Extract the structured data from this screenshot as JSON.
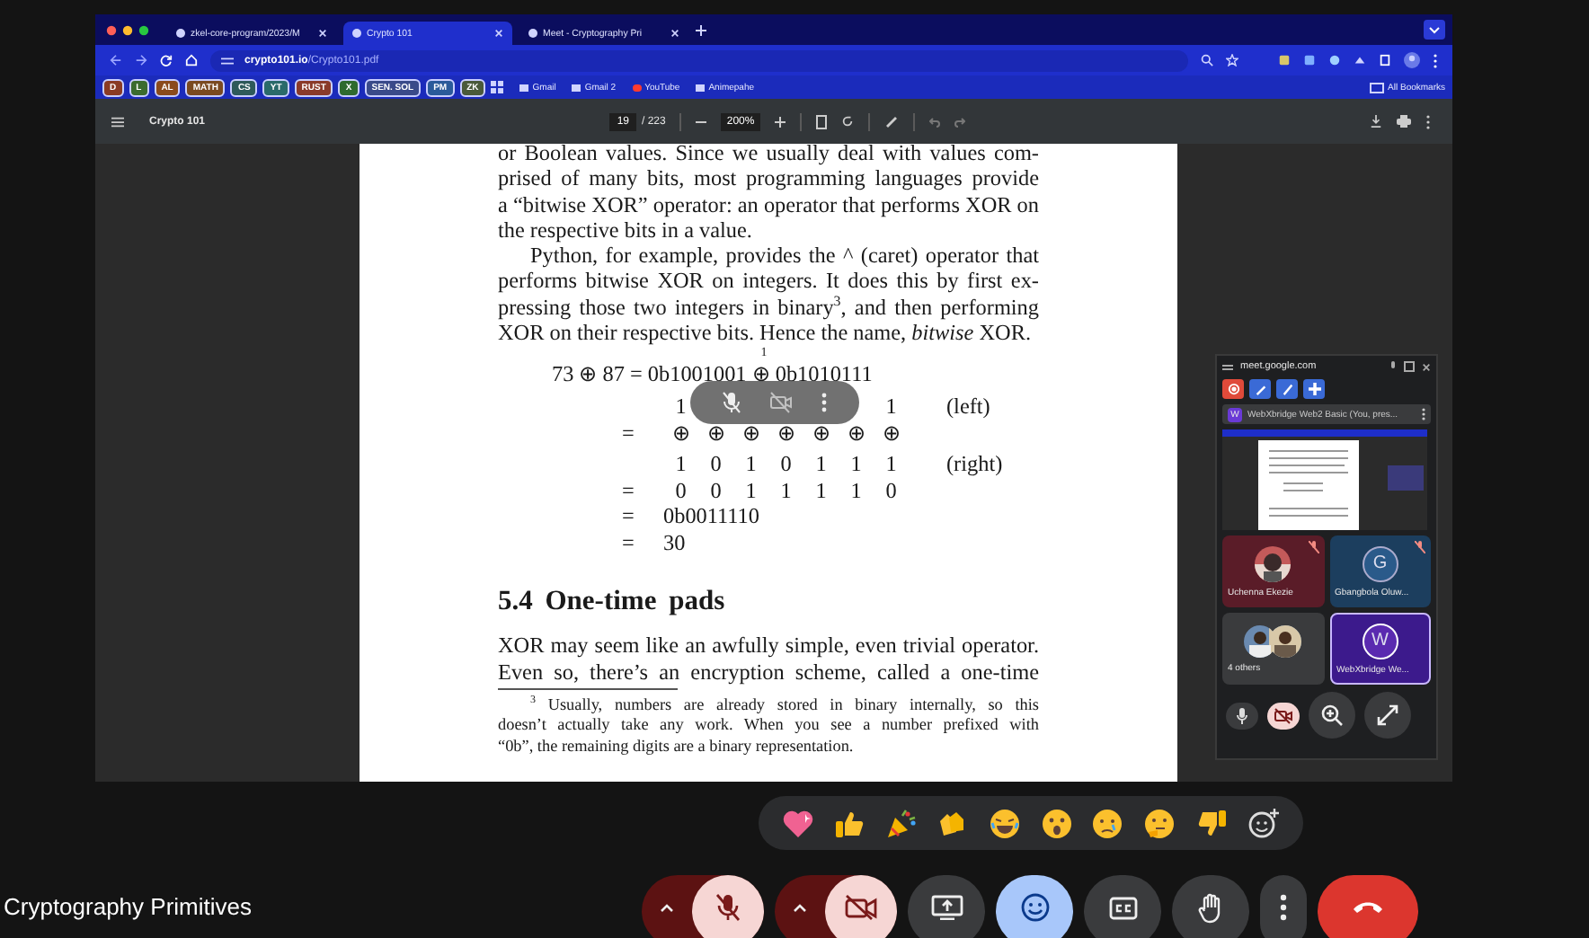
{
  "browser": {
    "tabs": [
      {
        "title": "zkel-core-program/2023/M",
        "selected": false
      },
      {
        "title": "Crypto 101",
        "selected": true
      },
      {
        "title": "Meet - Cryptography Pri",
        "selected": false
      }
    ],
    "url": {
      "host": "crypto101.io",
      "path": "/Crypto101.pdf"
    },
    "bookmarks": [
      {
        "label": "D",
        "kind": "chip",
        "color": "#8a3b24"
      },
      {
        "label": "L",
        "kind": "chip",
        "color": "#3b6b2e"
      },
      {
        "label": "AL",
        "kind": "chip",
        "color": "#8a4a1c"
      },
      {
        "label": "MATH",
        "kind": "chip",
        "color": "#7a4a20"
      },
      {
        "label": "CS",
        "kind": "chip",
        "color": "#2e5a5a"
      },
      {
        "label": "YT",
        "kind": "chip",
        "color": "#2a6a6a"
      },
      {
        "label": "RUST",
        "kind": "chip",
        "color": "#8a3a2a"
      },
      {
        "label": "X",
        "kind": "chip",
        "color": "#2e6a2e"
      },
      {
        "label": "SEN. SOL",
        "kind": "chip",
        "color": "#3a4a8a"
      },
      {
        "label": "PM",
        "kind": "chip",
        "color": "#2a5a9a"
      },
      {
        "label": "ZK",
        "kind": "chip",
        "color": "#4a5a3a"
      },
      {
        "label": "Gmail",
        "kind": "link"
      },
      {
        "label": "Gmail 2",
        "kind": "link"
      },
      {
        "label": "YouTube",
        "kind": "video"
      },
      {
        "label": "Animepahe",
        "kind": "link"
      }
    ],
    "all_bookmarks": "All Bookmarks"
  },
  "pdf": {
    "title": "Crypto 101",
    "page": "19",
    "page_count": "/ 223",
    "zoom": "200%",
    "paragraphs": [
      {
        "indent": false,
        "lines": [
          "or Boolean values. Since we usually deal with values com-",
          "prised of many bits, most programming languages provide",
          "a “bitwise XOR” operator: an operator that performs XOR on",
          "the respective bits in a value."
        ]
      },
      {
        "indent": true,
        "lines": [
          "Python, for example, provides the ^ (caret) operator that",
          "performs bitwise XOR on integers. It does this by first ex-",
          "pressing those two integers in binary$^{3}$, and then performing",
          "XOR on their respective bits. Hence the name, *bitwise* XOR."
        ]
      }
    ],
    "math": {
      "marker": "1",
      "equation": "73 ⊕ 87 = 0b1001001 ⊕ 0b1010111",
      "rows": [
        {
          "cells": [
            "1",
            "",
            "",
            "",
            "",
            "",
            "1"
          ],
          "note": "(left)"
        },
        {
          "op": "=",
          "cells": [
            "⊕",
            "⊕",
            "⊕",
            "⊕",
            "⊕",
            "⊕",
            "⊕"
          ]
        },
        {
          "cells": [
            "1",
            "0",
            "1",
            "0",
            "1",
            "1",
            "1"
          ],
          "note": "(right)"
        },
        {
          "op": "=",
          "cells": [
            "0",
            "0",
            "1",
            "1",
            "1",
            "1",
            "0"
          ]
        }
      ],
      "results": [
        {
          "op": "=",
          "value": "0b0011110"
        },
        {
          "op": "=",
          "value": "30"
        }
      ]
    },
    "heading": "5.4  One-time pads",
    "after_heading": [
      "XOR may seem like an awfully simple, even trivial operator.",
      "Even so, there’s an encryption scheme, called a one-time"
    ],
    "footnote": [
      "$^{3}$ Usually, numbers are already stored in binary internally, so this",
      "doesn’t actually take any work. When you see a number prefixed with",
      "“0b”, the remaining digits are a binary representation."
    ]
  },
  "pip": {
    "host": "meet.google.com",
    "presenter_initial": "W",
    "presenter": "WebXbridge Web2 Basic (You, pres...",
    "tiles": [
      {
        "name": "Uchenna Ekezie",
        "muted": true,
        "selected": false,
        "color": "#5a1c28"
      },
      {
        "kind": "letter",
        "initial": "G",
        "name": "Gbangbola Oluw...",
        "muted": true,
        "selected": false,
        "color": "#1c3e5e"
      },
      {
        "kind": "group",
        "name": "4 others",
        "muted": false,
        "selected": false,
        "color": "#3a3b3d"
      },
      {
        "kind": "letter",
        "initial": "W",
        "name": "WebXbridge We...",
        "muted": false,
        "selected": true,
        "color": "#3c1a8c"
      }
    ],
    "camera_on": false
  },
  "meeting": {
    "title": "Cryptography Primitives",
    "controls": [
      {
        "kind": "mic",
        "on": false
      },
      {
        "kind": "camera",
        "on": false
      },
      {
        "kind": "present"
      },
      {
        "kind": "reactions",
        "on": true
      },
      {
        "kind": "captions"
      },
      {
        "kind": "hand"
      },
      {
        "kind": "more"
      },
      {
        "kind": "end"
      }
    ]
  }
}
